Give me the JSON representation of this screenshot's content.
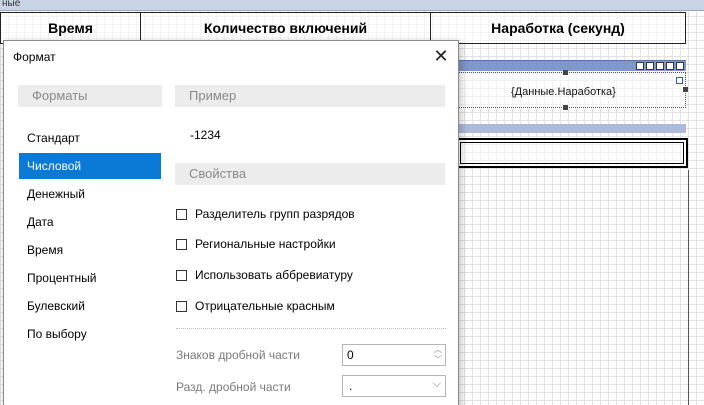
{
  "designer": {
    "band_label": "ные",
    "columns": [
      "Время",
      "Количество включений",
      "Наработка (секунд)"
    ],
    "data_expression": "{Данные.Наработка}"
  },
  "dialog": {
    "title": "Формат",
    "formats_header": "Форматы",
    "example_header": "Пример",
    "properties_header": "Свойства",
    "formats": [
      "Стандарт",
      "Числовой",
      "Денежный",
      "Дата",
      "Время",
      "Процентный",
      "Булевский",
      "По выбору"
    ],
    "selected_format": "Числовой",
    "example_value": "-1234",
    "checkboxes": [
      {
        "label": "Разделитель групп разрядов",
        "checked": false
      },
      {
        "label": "Региональные настройки",
        "checked": false
      },
      {
        "label": "Использовать аббревиатуру",
        "checked": false
      },
      {
        "label": "Отрицательные красным",
        "checked": false
      }
    ],
    "decimal_digits_label": "Знаков дробной части",
    "decimal_digits_value": "0",
    "decimal_separator_label": "Разд. дробной части",
    "decimal_separator_value": "."
  },
  "colors": {
    "selection": "#0a7ad6",
    "band_blue": "#7f97c9"
  }
}
